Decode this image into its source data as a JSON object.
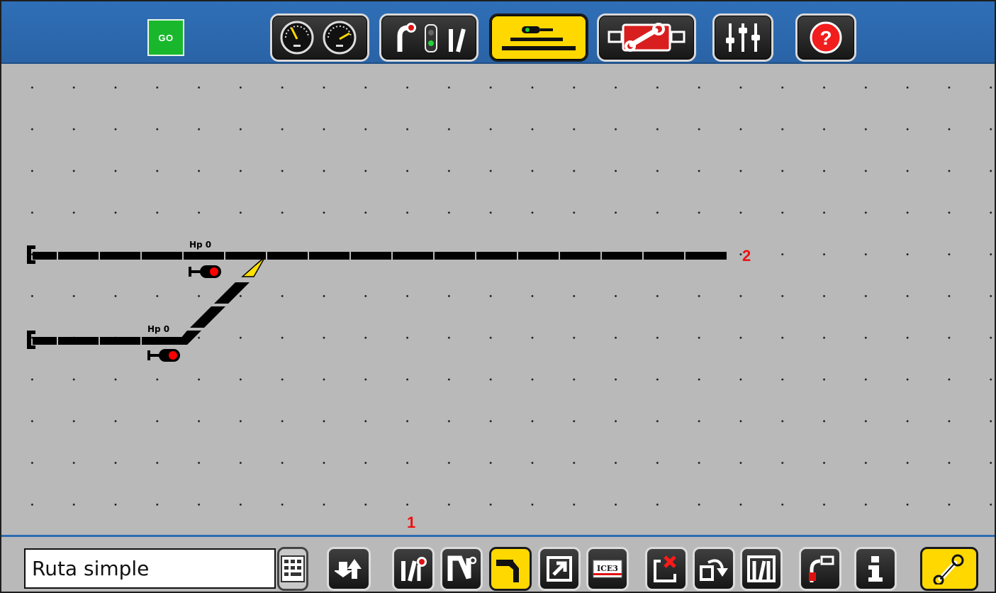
{
  "top_bar": {
    "go_label": "GO",
    "buttons": [
      {
        "name": "locomotive-control",
        "icon": "speedometer-icon"
      },
      {
        "name": "keyboard-articles",
        "icon": "signal-turnout-icon"
      },
      {
        "name": "track-layout",
        "icon": "track-layout-icon",
        "active": true
      },
      {
        "name": "system-setup",
        "icon": "wrench-device-icon"
      },
      {
        "name": "settings",
        "icon": "sliders-icon"
      },
      {
        "name": "help",
        "icon": "help-icon"
      }
    ]
  },
  "layout": {
    "signal_top_label": "Hp 0",
    "signal_bottom_label": "Hp 0",
    "callout_1": "1",
    "callout_2": "2"
  },
  "bottom_bar": {
    "layout_name": "Ruta simple",
    "buttons": [
      {
        "name": "keyboard",
        "icon": "keyboard-icon"
      },
      {
        "name": "page-up-down",
        "icon": "arrows-up-down-icon"
      },
      {
        "name": "add-signal-turnout",
        "icon": "signal-turnout-icon"
      },
      {
        "name": "add-sign",
        "icon": "sign-icon"
      },
      {
        "name": "add-track",
        "icon": "track-piece-icon",
        "active": true
      },
      {
        "name": "add-link",
        "icon": "link-arrow-icon"
      },
      {
        "name": "add-train-display",
        "icon": "ice3-icon",
        "text": "ICE3"
      },
      {
        "name": "delete-element",
        "icon": "delete-icon"
      },
      {
        "name": "rotate-element",
        "icon": "rotate-icon"
      },
      {
        "name": "mirror-element",
        "icon": "mirror-icon"
      },
      {
        "name": "edit-element",
        "icon": "edit-icon"
      },
      {
        "name": "info",
        "icon": "info-icon"
      },
      {
        "name": "edit-mode",
        "icon": "wrench-icon",
        "active": true
      }
    ]
  },
  "colors": {
    "top_bar": "#2f6fb7",
    "canvas": "#b9b9b9",
    "active": "#ffd800",
    "go": "#19b82c",
    "callout": "#ee1111",
    "signal_red": "#ff0000",
    "turnout_yellow": "#ffe000"
  }
}
